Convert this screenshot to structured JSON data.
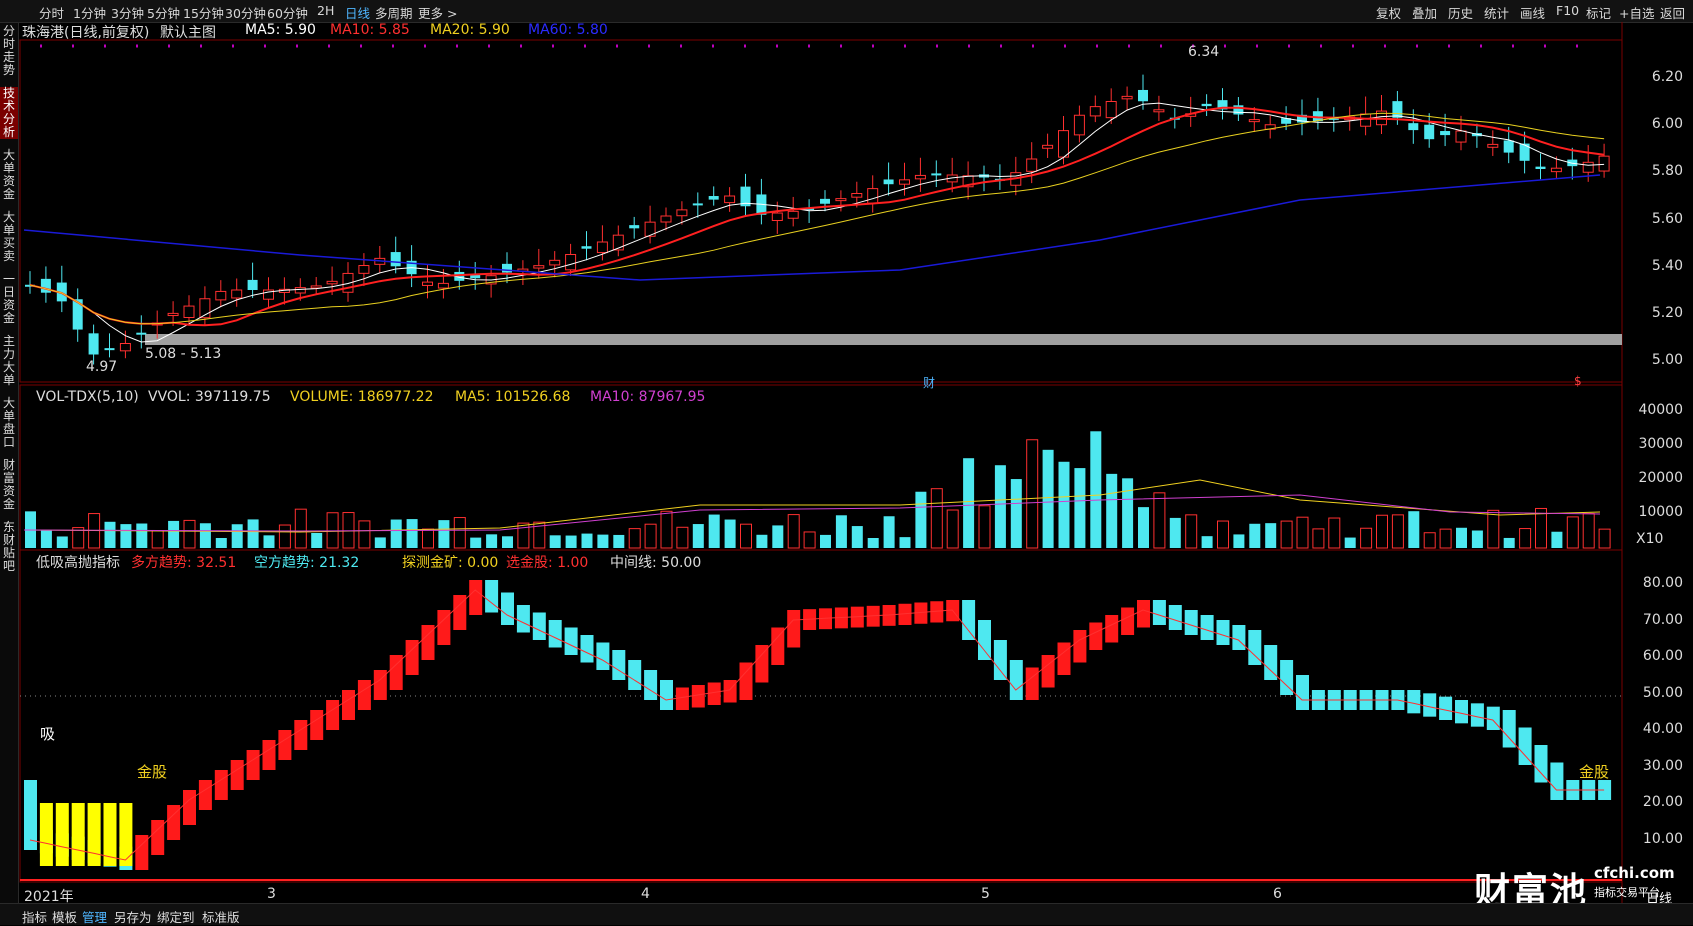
{
  "toolbar": {
    "periods": [
      "分时",
      "1分钟",
      "3分钟",
      "5分钟",
      "15分钟",
      "30分钟",
      "60分钟",
      "2H",
      "日线",
      "多周期",
      "更多 >"
    ],
    "active_period": "日线",
    "right_buttons": [
      "复权",
      "叠加",
      "历史",
      "统计",
      "画线",
      "F10",
      "标记",
      "+自选",
      "返回"
    ]
  },
  "sidebar": {
    "tabs": [
      "分时走势",
      "技术分析",
      "大单资金",
      "大单买卖",
      "一日资金",
      "主力大单",
      "大单盘口",
      "财富资金",
      "东财贴吧"
    ],
    "active": "技术分析"
  },
  "main_panel": {
    "stock": "珠海港(日线,前复权)",
    "chart_name": "默认主图",
    "ma5": "MA5: 5.90",
    "ma10": "MA10: 5.85",
    "ma20": "MA20: 5.90",
    "ma60": "MA60: 5.80",
    "high_label": "6.34",
    "low_label": "4.97",
    "range_label": "5.08 - 5.13",
    "price_axis": [
      "6.20",
      "6.00",
      "5.80",
      "5.60",
      "5.40",
      "5.20",
      "5.00"
    ],
    "marker_cai": "财",
    "marker_dollar": "$",
    "ma_colors": {
      "ma5": "#ffffff",
      "ma10": "#ff2020",
      "ma20": "#e8d020",
      "ma60": "#1a1ad8"
    }
  },
  "volume_panel": {
    "name": "VOL-TDX(5,10)",
    "vvol": "VVOL: 397119.75",
    "volume": "VOLUME: 186977.22",
    "ma5": "MA5: 101526.68",
    "ma10": "MA10: 87967.95",
    "axis": [
      "40000",
      "30000",
      "20000",
      "10000"
    ],
    "unit": "X10"
  },
  "indicator_panel": {
    "name": "低吸高抛指标",
    "bull": "多方趋势: 32.51",
    "bear": "空方趋势: 21.32",
    "probe": "探测金矿: 0.00",
    "pick": "选金股: 1.00",
    "mid": "中间线: 50.00",
    "axis": [
      "80.00",
      "70.00",
      "60.00",
      "50.00",
      "40.00",
      "30.00",
      "20.00",
      "10.00"
    ],
    "label_xi": "吸",
    "label_gold_left": "金股",
    "label_gold_right": "金股"
  },
  "x_axis": {
    "year": "2021年",
    "months": [
      "3",
      "4",
      "5",
      "6"
    ]
  },
  "watermark": {
    "brand": "财富池",
    "domain": "cfchi.com",
    "tagline": "指标交易平台",
    "period_tag": "日线"
  },
  "bottom_tabs": [
    "指标",
    "模板",
    "管理",
    "另存为",
    "绑定到",
    "标准版"
  ],
  "bottom_active": "管理"
}
